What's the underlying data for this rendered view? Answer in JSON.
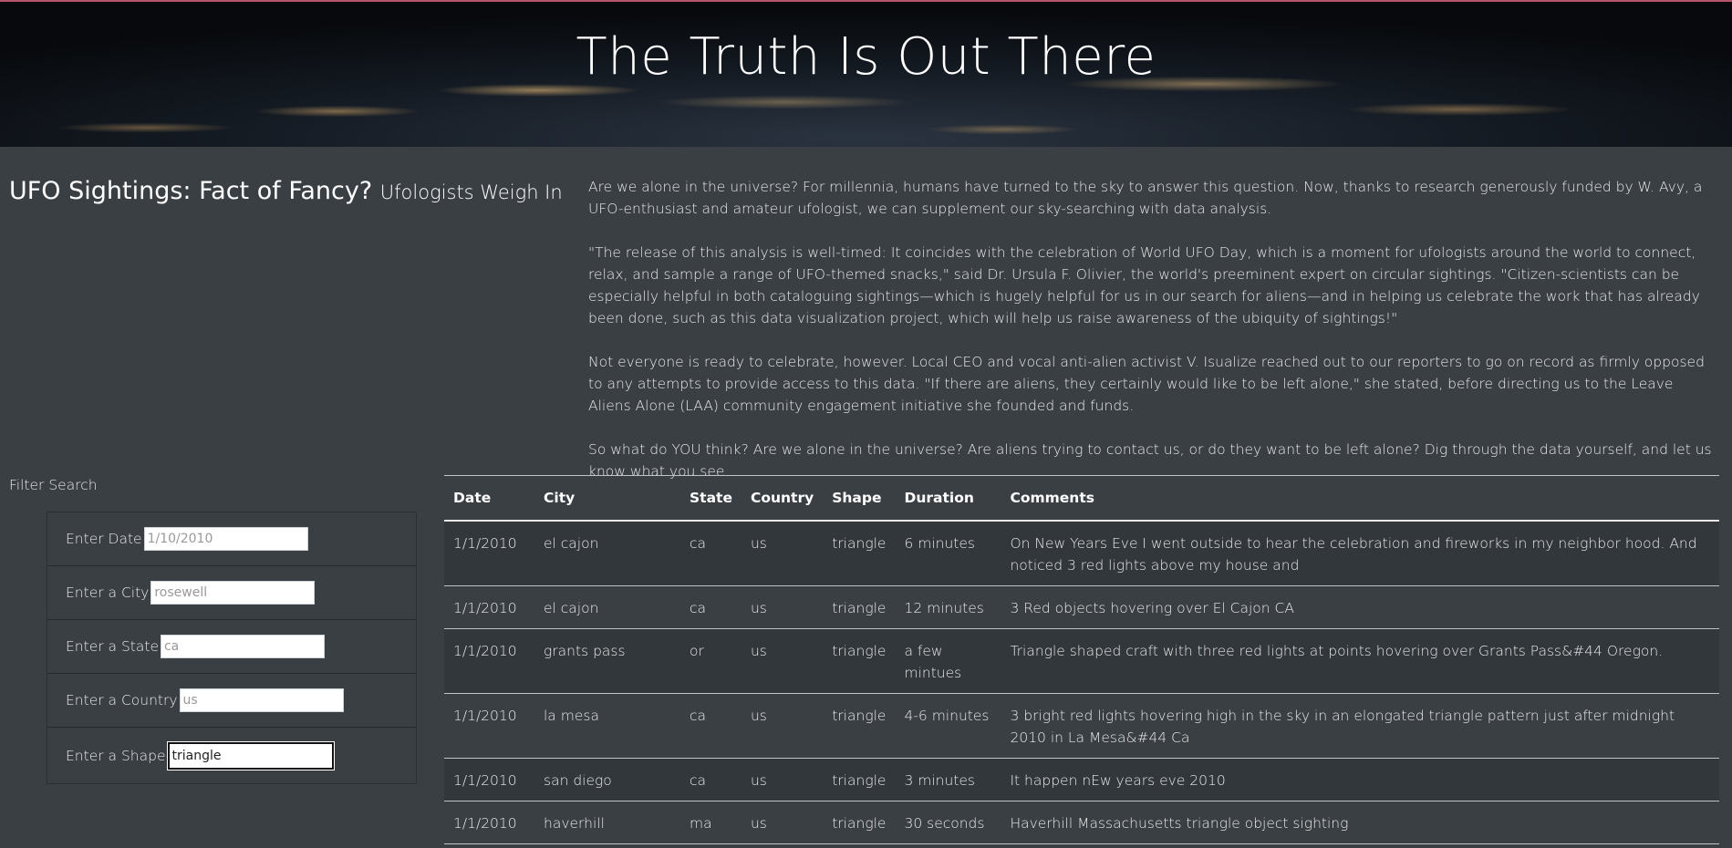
{
  "header": {
    "title": "The Truth Is Out There"
  },
  "page": {
    "heading": "UFO Sightings: Fact of Fancy?",
    "subheading": "Ufologists Weigh In"
  },
  "article": {
    "paragraphs": [
      "Are we alone in the universe? For millennia, humans have turned to the sky to answer this question. Now, thanks to research generously funded by W. Avy, a UFO-enthusiast and amateur ufologist, we can supplement our sky-searching with data analysis.",
      "\"The release of this analysis is well-timed: It coincides with the celebration of World UFO Day, which is a moment for ufologists around the world to connect, relax, and sample a range of UFO-themed snacks,\" said Dr. Ursula F. Olivier, the world's preeminent expert on circular sightings. \"Citizen-scientists can be especially helpful in both cataloguing sightings—which is hugely helpful for us in our search for aliens—and in helping us celebrate the work that has already been done, such as this data visualization project, which will help us raise awareness of the ubiquity of sightings!\"",
      "Not everyone is ready to celebrate, however. Local CEO and vocal anti-alien activist V. Isualize reached out to our reporters to go on record as firmly opposed to any attempts to provide access to this data. \"If there are aliens, they certainly would like to be left alone,\" she stated, before directing us to the Leave Aliens Alone (LAA) community engagement initiative she founded and funds.",
      "So what do YOU think? Are we alone in the universe? Are aliens trying to contact us, or do they want to be left alone? Dig through the data yourself, and let us know what you see."
    ]
  },
  "filters": {
    "title": "Filter Search",
    "items": [
      {
        "label": "Enter Date",
        "placeholder": "1/10/2010",
        "value": ""
      },
      {
        "label": "Enter a City",
        "placeholder": "rosewell",
        "value": ""
      },
      {
        "label": "Enter a State",
        "placeholder": "ca",
        "value": ""
      },
      {
        "label": "Enter a Country",
        "placeholder": "us",
        "value": ""
      },
      {
        "label": "Enter a Shape",
        "placeholder": "",
        "value": "triangle"
      }
    ]
  },
  "table": {
    "headers": [
      "Date",
      "City",
      "State",
      "Country",
      "Shape",
      "Duration",
      "Comments"
    ],
    "rows": [
      [
        "1/1/2010",
        "el cajon",
        "ca",
        "us",
        "triangle",
        "6 minutes",
        "On New Years Eve I went outside to hear the celebration and fireworks in my neighbor hood. And noticed 3 red lights above my house and"
      ],
      [
        "1/1/2010",
        "el cajon",
        "ca",
        "us",
        "triangle",
        "12 minutes",
        "3 Red objects hovering over El Cajon CA"
      ],
      [
        "1/1/2010",
        "grants pass",
        "or",
        "us",
        "triangle",
        "a few mintues",
        "Triangle shaped craft with three red lights at points hovering over Grants Pass&#44 Oregon."
      ],
      [
        "1/1/2010",
        "la mesa",
        "ca",
        "us",
        "triangle",
        "4-6 minutes",
        "3 bright red lights hovering high in the sky in an elongated triangle pattern just after midnight 2010 in La Mesa&#44 Ca"
      ],
      [
        "1/1/2010",
        "san diego",
        "ca",
        "us",
        "triangle",
        "3 minutes",
        "It happen nEw years eve 2010"
      ],
      [
        "1/1/2010",
        "haverhill",
        "ma",
        "us",
        "triangle",
        "30 seconds",
        "Haverhill Massachusetts triangle object sighting"
      ]
    ]
  },
  "colors": {
    "background": "#3a3f44",
    "header_accent": "#b5566c",
    "row_stripe": "#32373b",
    "text": "#e8e8e8"
  }
}
